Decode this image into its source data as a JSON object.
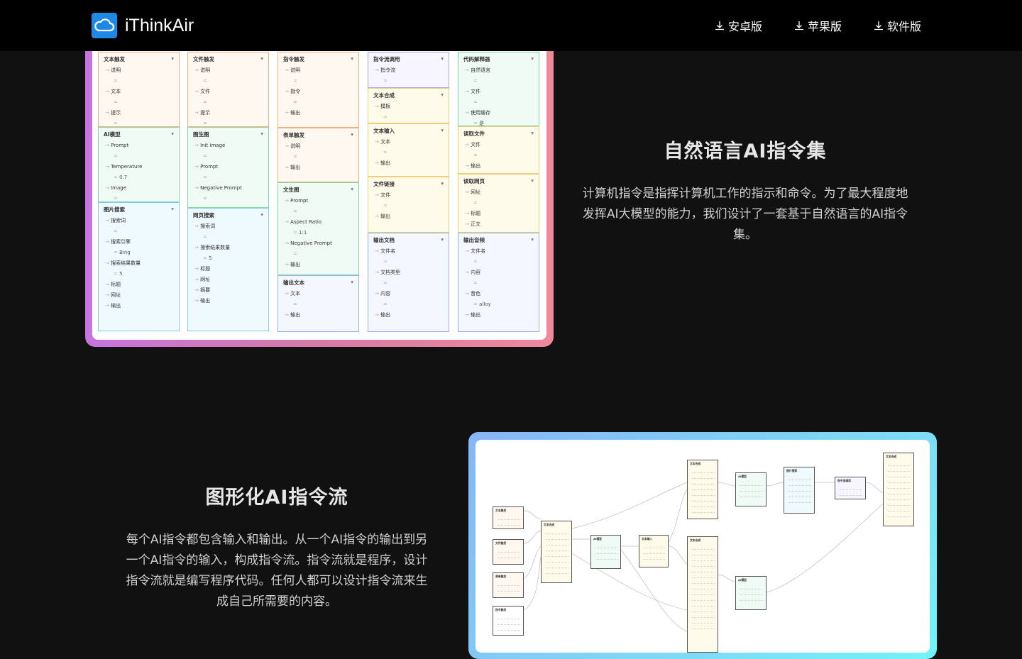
{
  "header": {
    "brand": "iThinkAir",
    "nav": [
      {
        "label": "安卓版",
        "icon": "download-icon"
      },
      {
        "label": "苹果版",
        "icon": "download-icon"
      },
      {
        "label": "软件版",
        "icon": "download-icon"
      }
    ]
  },
  "section1": {
    "title": "自然语言AI指令集",
    "desc": "计算机指令是指挥计算机工作的指示和命令。为了最大程度地发挥AI大模型的能力，我们设计了一套基于自然语言的AI指令集。"
  },
  "section2": {
    "title": "图形化AI指令流",
    "desc": "每个AI指令都包含输入和输出。从一个AI指令的输出到另一个AI指令的输入，构成指令流。指令流就是程序，设计指令流就是编写程序代码。任何人都可以设计指令流来生成自己所需要的内容。"
  },
  "colors": {
    "header_bg": "#000000",
    "page_bg": "#111111",
    "logo_blue": "#1e88e5"
  },
  "instruction_nodes": {
    "col1": [
      {
        "title": "文本触发",
        "rows": [
          {
            "label": "说明",
            "sub": ""
          },
          {
            "label": "文本",
            "sub": ""
          },
          {
            "label": "提示",
            "sub": ""
          }
        ]
      },
      {
        "title": "AI模型",
        "rows": [
          {
            "label": "Prompt",
            "sub": ""
          },
          {
            "label": "Temperature",
            "sub": "0.7"
          },
          {
            "label": "Image",
            "sub": ""
          }
        ]
      },
      {
        "title": "图片搜索",
        "rows": [
          {
            "label": "搜索词",
            "sub": ""
          },
          {
            "label": "搜索引擎",
            "sub": "Bing"
          },
          {
            "label": "搜索结果数量",
            "sub": "5"
          },
          {
            "label": "标题",
            "sub": null
          },
          {
            "label": "网址",
            "sub": null
          },
          {
            "label": "输出",
            "sub": null
          }
        ]
      }
    ],
    "col2": [
      {
        "title": "文件触发",
        "rows": [
          {
            "label": "说明",
            "sub": ""
          },
          {
            "label": "文件",
            "sub": ""
          },
          {
            "label": "提示",
            "sub": ""
          }
        ]
      },
      {
        "title": "图生图",
        "rows": [
          {
            "label": "Init image",
            "sub": ""
          },
          {
            "label": "Prompt",
            "sub": ""
          },
          {
            "label": "Negative Prompt",
            "sub": ""
          }
        ]
      },
      {
        "title": "网页搜索",
        "rows": [
          {
            "label": "搜索词",
            "sub": ""
          },
          {
            "label": "搜索结果数量",
            "sub": "5"
          },
          {
            "label": "标题",
            "sub": null
          },
          {
            "label": "网址",
            "sub": null
          },
          {
            "label": "摘要",
            "sub": null
          },
          {
            "label": "输出",
            "sub": null
          }
        ]
      }
    ],
    "col3": [
      {
        "title": "指令触发",
        "rows": [
          {
            "label": "说明",
            "sub": ""
          },
          {
            "label": "指令",
            "sub": ""
          },
          {
            "label": "输出",
            "sub": null
          }
        ]
      },
      {
        "title": "表单触发",
        "rows": [
          {
            "label": "说明",
            "sub": ""
          },
          {
            "label": "输出",
            "sub": null
          }
        ]
      },
      {
        "title": "文生图",
        "rows": [
          {
            "label": "Prompt",
            "sub": ""
          },
          {
            "label": "Aspect Ratio",
            "sub": "1:1"
          },
          {
            "label": "Negative Prompt",
            "sub": ""
          },
          {
            "label": "输出",
            "sub": null
          }
        ]
      },
      {
        "title": "输出文本",
        "rows": [
          {
            "label": "文本",
            "sub": ""
          },
          {
            "label": "输出",
            "sub": null
          }
        ]
      }
    ],
    "col4": [
      {
        "title": "指令流调用",
        "rows": [
          {
            "label": "指令流",
            "sub": ""
          }
        ]
      },
      {
        "title": "文本合成",
        "rows": [
          {
            "label": "模板",
            "sub": ""
          }
        ]
      },
      {
        "title": "文本输入",
        "rows": [
          {
            "label": "文本",
            "sub": ""
          },
          {
            "label": "输出",
            "sub": null
          }
        ]
      },
      {
        "title": "文件链接",
        "rows": [
          {
            "label": "文件",
            "sub": ""
          },
          {
            "label": "输出",
            "sub": null
          }
        ]
      },
      {
        "title": "输出文档",
        "rows": [
          {
            "label": "文件名",
            "sub": ""
          },
          {
            "label": "文档类型",
            "sub": ""
          },
          {
            "label": "内容",
            "sub": ""
          },
          {
            "label": "输出",
            "sub": null
          }
        ]
      }
    ],
    "col5": [
      {
        "title": "代码解释器",
        "rows": [
          {
            "label": "自然语言",
            "sub": ""
          },
          {
            "label": "文件",
            "sub": ""
          },
          {
            "label": "使用缓存",
            "sub": "是"
          }
        ]
      },
      {
        "title": "读取文件",
        "rows": [
          {
            "label": "文件",
            "sub": ""
          },
          {
            "label": "输出",
            "sub": null
          }
        ]
      },
      {
        "title": "读取网页",
        "rows": [
          {
            "label": "网址",
            "sub": ""
          },
          {
            "label": "标题",
            "sub": null
          },
          {
            "label": "正文",
            "sub": null
          }
        ]
      },
      {
        "title": "输出音频",
        "rows": [
          {
            "label": "文件名",
            "sub": ""
          },
          {
            "label": "内容",
            "sub": ""
          },
          {
            "label": "音色",
            "sub": "alloy"
          },
          {
            "label": "输出",
            "sub": null
          }
        ]
      }
    ]
  }
}
